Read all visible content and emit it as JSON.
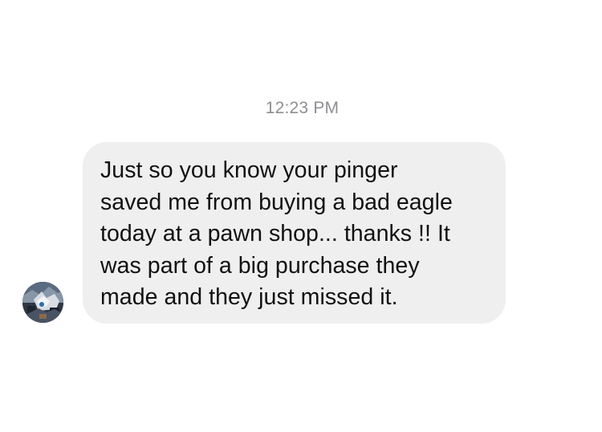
{
  "conversation": {
    "timestamp": "12:23 PM",
    "messages": [
      {
        "direction": "incoming",
        "sender_avatar_icon": "user-avatar-photo",
        "lines": [
          "Just so you know your pinger",
          "saved me from buying a bad eagle",
          "today at a pawn shop... thanks !! It",
          "was part of a big purchase they",
          "made and they just missed it."
        ]
      }
    ]
  },
  "colors": {
    "background": "#ffffff",
    "incoming_bubble": "#efeff0",
    "timestamp_text": "#8e8e93",
    "message_text": "#111111"
  }
}
